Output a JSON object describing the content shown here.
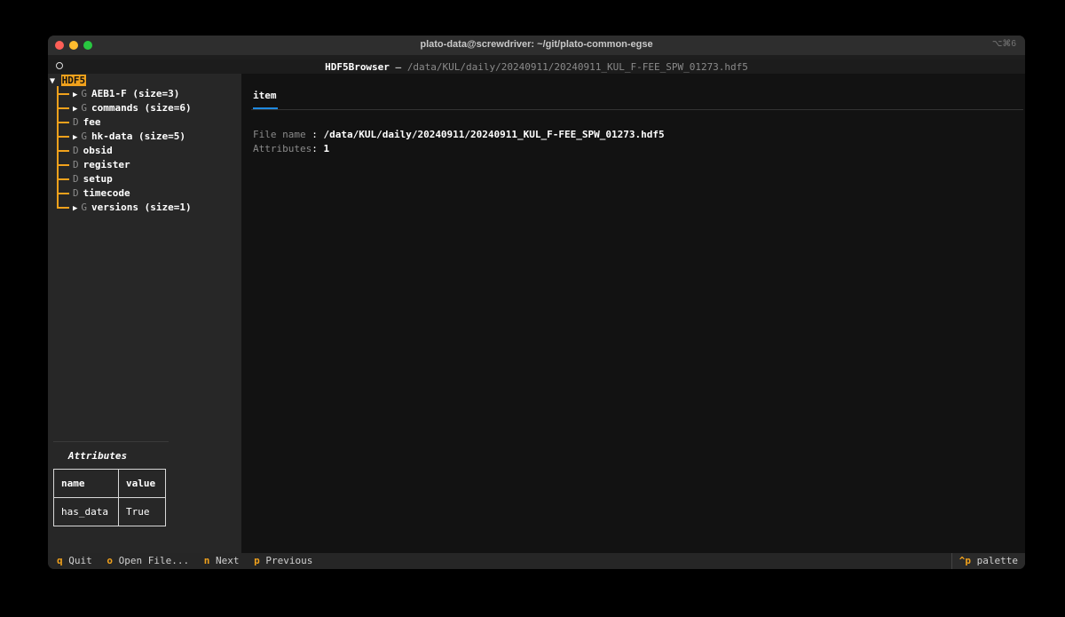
{
  "window": {
    "title": "plato-data@screwdriver: ~/git/plato-common-egse",
    "shortcut": "⌥⌘6"
  },
  "header": {
    "app": "HDF5Browser",
    "sep": " — ",
    "path": "/data/KUL/daily/20240911/20240911_KUL_F-FEE_SPW_01273.hdf5"
  },
  "tree": {
    "root_arrow": "▼",
    "root_label": "HDF5",
    "items": [
      {
        "expander": "▶",
        "kind": "G",
        "name": "AEB1-F (size=3)"
      },
      {
        "expander": "▶",
        "kind": "G",
        "name": "commands (size=6)"
      },
      {
        "expander": "",
        "kind": "D",
        "name": "fee"
      },
      {
        "expander": "▶",
        "kind": "G",
        "name": "hk-data (size=5)"
      },
      {
        "expander": "",
        "kind": "D",
        "name": "obsid"
      },
      {
        "expander": "",
        "kind": "D",
        "name": "register"
      },
      {
        "expander": "",
        "kind": "D",
        "name": "setup"
      },
      {
        "expander": "",
        "kind": "D",
        "name": "timecode"
      },
      {
        "expander": "▶",
        "kind": "G",
        "name": "versions (size=1)"
      }
    ]
  },
  "attributes": {
    "title": "Attributes",
    "headers": [
      "name",
      "value"
    ],
    "rows": [
      [
        "has_data",
        "True"
      ]
    ]
  },
  "main": {
    "tab": "item",
    "file_name_label": "File name",
    "file_name_value": "/data/KUL/daily/20240911/20240911_KUL_F-FEE_SPW_01273.hdf5",
    "attributes_label": "Attributes",
    "attributes_value": "1",
    "colon": ": "
  },
  "footer": {
    "items": [
      {
        "key": "q",
        "label": "Quit"
      },
      {
        "key": "o",
        "label": "Open File..."
      },
      {
        "key": "n",
        "label": "Next"
      },
      {
        "key": "p",
        "label": "Previous"
      }
    ],
    "palette_key": "^p",
    "palette_label": "palette"
  },
  "colors": {
    "accent": "#f0a11c",
    "tab_underline": "#1f8ae0"
  }
}
